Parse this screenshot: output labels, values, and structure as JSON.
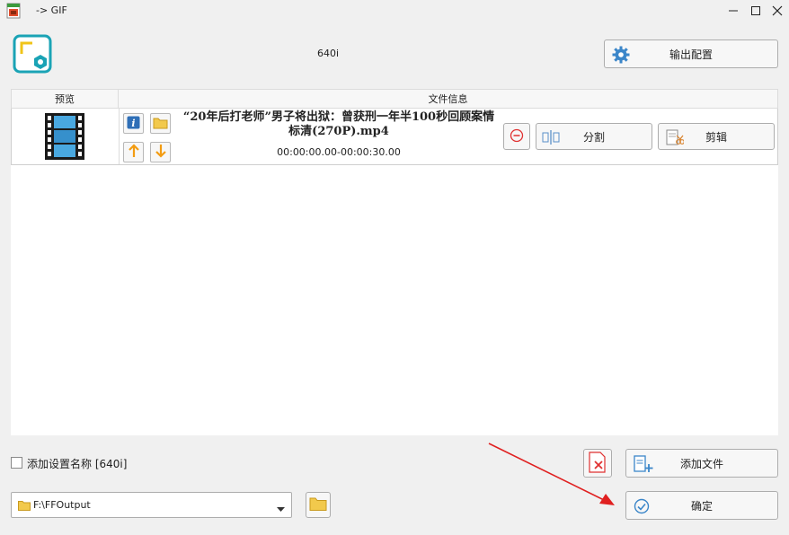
{
  "window": {
    "title": "-> GIF",
    "icons": {
      "app": "gif-app-icon",
      "minimize": "minimize-icon",
      "maximize": "maximize-icon",
      "close": "close-icon"
    }
  },
  "header": {
    "preset_name": "640i",
    "output_config_label": "输出配置",
    "logo_icon": "video-settings-icon",
    "gear_icon": "gear-icon"
  },
  "table": {
    "columns": [
      "预览",
      "文件信息"
    ],
    "rows": [
      {
        "thumbnail_icon": "film-strip-icon",
        "title": "“20年后打老师”男子将出狱：曾获刑一年半100秒回顾案情 标清(270P).mp4",
        "time_range": "00:00:00.00-00:00:30.00",
        "split_label": "分割",
        "trim_label": "剪辑"
      }
    ]
  },
  "bottom": {
    "add_preset_name_label": "添加设置名称 [640i]",
    "add_preset_name_checked": false,
    "add_file_label": "添加文件",
    "output_folder": "F:\\FFOutput",
    "ok_label": "确定"
  },
  "colors": {
    "accent_teal": "#1aa3b5",
    "orange": "#f39c12",
    "red": "#e03030",
    "blue_icon": "#3b86c9"
  }
}
